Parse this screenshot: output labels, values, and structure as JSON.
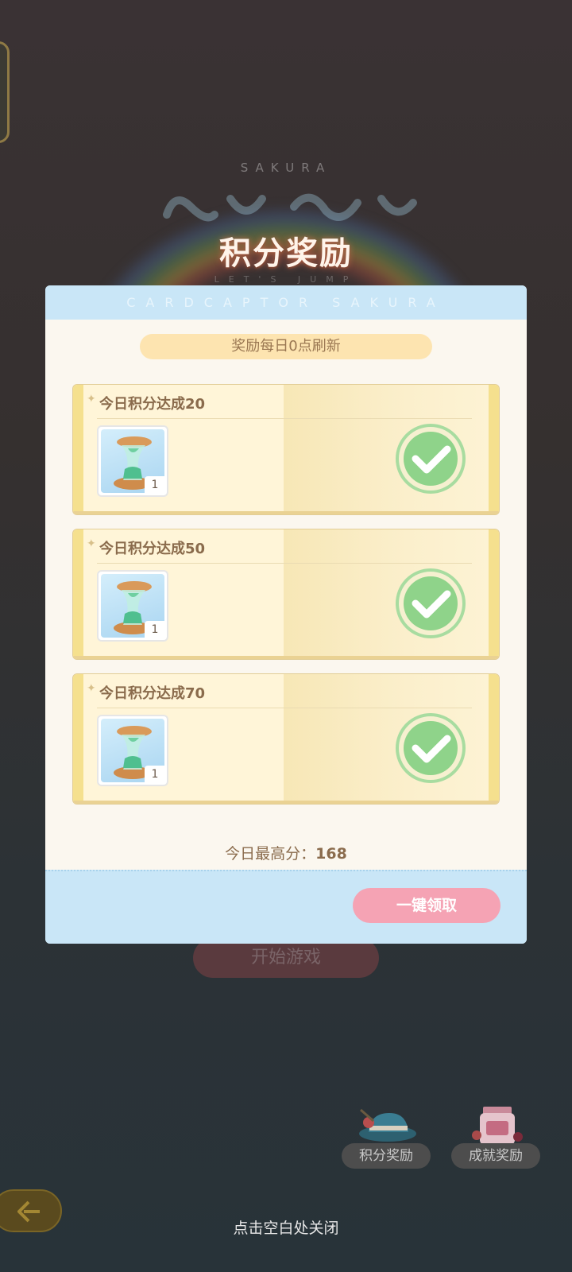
{
  "background": {
    "logo_top_text": "SAKURA",
    "logo_sub_text": "LET'S JUMP",
    "start_button_label": "开始游戏",
    "bottom_tabs": [
      {
        "label": "积分奖励",
        "icon": "hat-icon"
      },
      {
        "label": "成就奖励",
        "icon": "jar-icon"
      }
    ],
    "close_hint": "点击空白处关闭"
  },
  "dialog": {
    "title": "积分奖励",
    "header_banner": "CARDCAPTOR SAKURA",
    "refresh_notice": "奖励每日0点刷新",
    "rewards": [
      {
        "title": "今日积分达成20",
        "item_icon": "hourglass-icon",
        "item_count": "1",
        "status": "claimed"
      },
      {
        "title": "今日积分达成50",
        "item_icon": "hourglass-icon",
        "item_count": "1",
        "status": "claimed"
      },
      {
        "title": "今日积分达成70",
        "item_icon": "hourglass-icon",
        "item_count": "1",
        "status": "claimed"
      }
    ],
    "best_score_label": "今日最高分：",
    "best_score_value": "168",
    "claim_all_label": "一键领取"
  },
  "colors": {
    "header_blue": "#c9e6f7",
    "card_yellow": "#fff5d8",
    "check_green": "#8fd38a",
    "claim_pink": "#f5a3b4",
    "text_brown": "#8a6b4c"
  }
}
